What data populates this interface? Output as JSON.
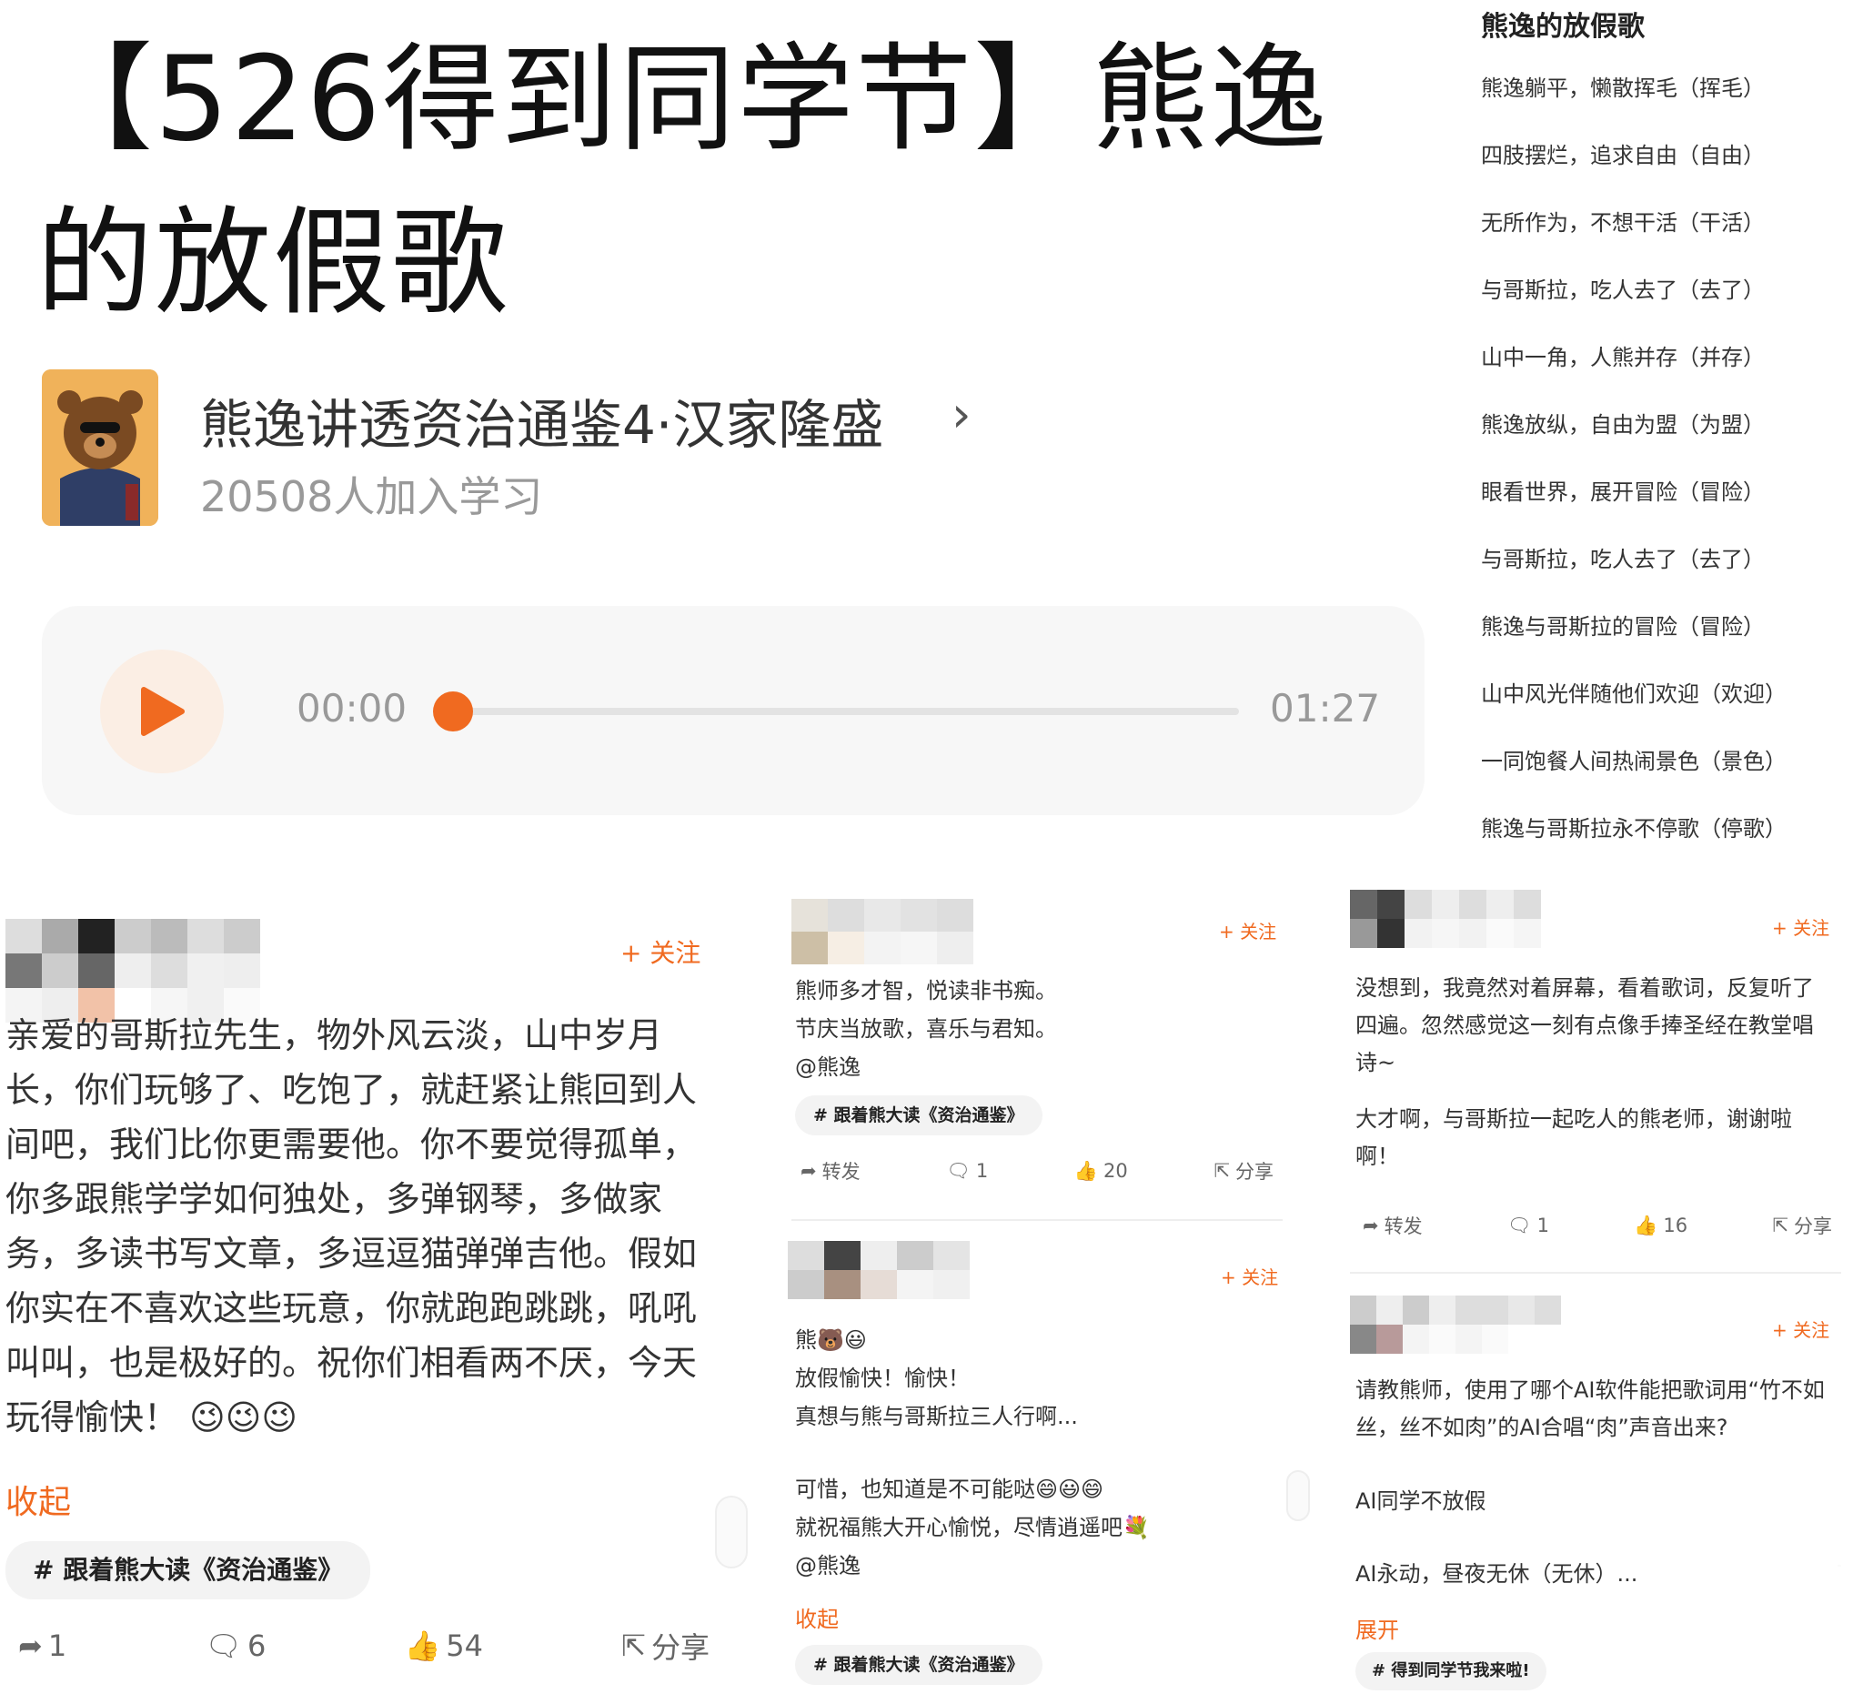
{
  "title": "【526得到同学节】熊逸的放假歌",
  "course": {
    "name": "熊逸讲透资治通鉴4·汉家隆盛",
    "count": "20508人加入学习"
  },
  "player": {
    "start": "00:00",
    "end": "01:27",
    "progress": 0
  },
  "lyrics": {
    "title": "熊逸的放假歌",
    "lines": [
      "熊逸躺平，懒散挥毛（挥毛）",
      "四肢摆烂，追求自由（自由）",
      "无所作为，不想干活（干活）",
      "与哥斯拉，吃人去了（去了）",
      "山中一角，人熊并存（并存）",
      "熊逸放纵，自由为盟（为盟）",
      "眼看世界，展开冒险（冒险）",
      "与哥斯拉，吃人去了（去了）",
      "熊逸与哥斯拉的冒险（冒险）",
      "山中风光伴随他们欢迎（欢迎）",
      "一同饱餐人间热闹景色（景色）",
      "熊逸与哥斯拉永不停歌（停歌）"
    ]
  },
  "comments": {
    "c1": {
      "follow": "+ 关注",
      "text": "亲爱的哥斯拉先生，物外风云淡，山中岁月长，你们玩够了、吃饱了，就赶紧让熊回到人间吧，我们比你更需要他。你不要觉得孤单，你多跟熊学学如何独处，多弹钢琴，多做家务，多读书写文章，多逗逗猫弹弹吉他。假如你实在不喜欢这些玩意，你就跑跑跳跳，吼吼叫叫，也是极好的。祝你们相看两不厌，今天玩得愉快！",
      "emoji": "😉😉😉",
      "collapse": "收起",
      "tag": "# 跟着熊大读《资治通鉴》",
      "repost": "1",
      "comment": "6",
      "like": "54",
      "share": "分享"
    },
    "c2": {
      "follow": "+ 关注",
      "lines": [
        "熊师多才智，悦读非书痴。",
        "节庆当放歌，喜乐与君知。",
        "@熊逸"
      ],
      "tag": "# 跟着熊大读《资治通鉴》",
      "repost": "转发",
      "comment": "1",
      "like": "20",
      "share": "分享"
    },
    "c3": {
      "follow": "+ 关注",
      "p1": "没想到，我竟然对着屏幕，看着歌词，反复听了四遍。忽然感觉这一刻有点像手捧圣经在教堂唱诗~",
      "p2": "大才啊，与哥斯拉一起吃人的熊老师，谢谢啦啊！",
      "repost": "转发",
      "comment": "1",
      "like": "16",
      "share": "分享"
    },
    "c4": {
      "follow": "+ 关注",
      "lines": [
        "熊🐻😃",
        "放假愉快！愉快！",
        "真想与熊与哥斯拉三人行啊..."
      ],
      "lines2": [
        "可惜，也知道是不可能哒😄😃😄",
        "就祝福熊大开心愉悦，尽情逍遥吧💐",
        "@熊逸"
      ],
      "collapse": "收起",
      "tag": "# 跟着熊大读《资治通鉴》"
    },
    "c5": {
      "follow": "+ 关注",
      "p1": "请教熊师，使用了哪个AI软件能把歌词用“竹不如丝，丝不如肉”的AI合唱“肉”声音出来?",
      "p2": "AI同学不放假",
      "p3": "AI永动，昼夜无休（无休）...",
      "expand": "展开",
      "tag": "# 得到同学节我来啦!"
    }
  }
}
